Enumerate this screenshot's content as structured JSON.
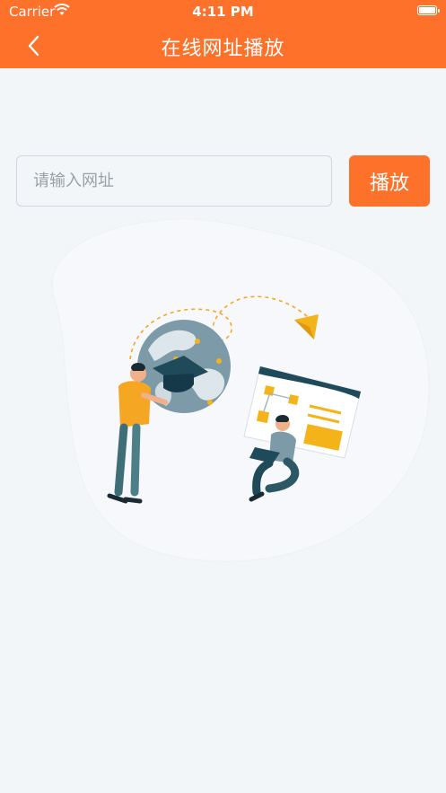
{
  "status_bar": {
    "carrier": "Carrier",
    "time": "4:11 PM"
  },
  "nav": {
    "title": "在线网址播放",
    "back_icon": "chevron-left-icon"
  },
  "url_form": {
    "placeholder": "请输入网址",
    "value": "",
    "play_label": "播放"
  },
  "colors": {
    "accent": "#fe712a",
    "background": "#f3f6f9"
  }
}
